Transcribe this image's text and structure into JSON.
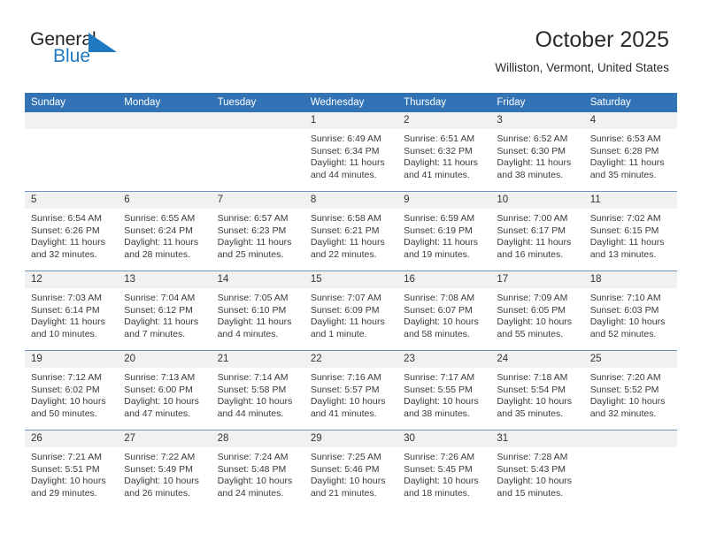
{
  "brand": {
    "name_part1": "General",
    "name_part2": "Blue",
    "triangle_color": "#1f79c0",
    "text_color": "#231f20",
    "accent_color": "#1f79c0"
  },
  "header": {
    "title": "October 2025",
    "subtitle": "Williston, Vermont, United States"
  },
  "theme": {
    "header_blue": "#3273b5",
    "daynum_band": "#f1f1f1",
    "row_border": "#6d93bb"
  },
  "calendar": {
    "weekday_headers": [
      "Sunday",
      "Monday",
      "Tuesday",
      "Wednesday",
      "Thursday",
      "Friday",
      "Saturday"
    ],
    "weeks": [
      [
        {
          "day": "",
          "empty": true
        },
        {
          "day": "",
          "empty": true
        },
        {
          "day": "",
          "empty": true
        },
        {
          "day": "1",
          "sunrise": "Sunrise: 6:49 AM",
          "sunset": "Sunset: 6:34 PM",
          "daylight": "Daylight: 11 hours and 44 minutes."
        },
        {
          "day": "2",
          "sunrise": "Sunrise: 6:51 AM",
          "sunset": "Sunset: 6:32 PM",
          "daylight": "Daylight: 11 hours and 41 minutes."
        },
        {
          "day": "3",
          "sunrise": "Sunrise: 6:52 AM",
          "sunset": "Sunset: 6:30 PM",
          "daylight": "Daylight: 11 hours and 38 minutes."
        },
        {
          "day": "4",
          "sunrise": "Sunrise: 6:53 AM",
          "sunset": "Sunset: 6:28 PM",
          "daylight": "Daylight: 11 hours and 35 minutes."
        }
      ],
      [
        {
          "day": "5",
          "sunrise": "Sunrise: 6:54 AM",
          "sunset": "Sunset: 6:26 PM",
          "daylight": "Daylight: 11 hours and 32 minutes."
        },
        {
          "day": "6",
          "sunrise": "Sunrise: 6:55 AM",
          "sunset": "Sunset: 6:24 PM",
          "daylight": "Daylight: 11 hours and 28 minutes."
        },
        {
          "day": "7",
          "sunrise": "Sunrise: 6:57 AM",
          "sunset": "Sunset: 6:23 PM",
          "daylight": "Daylight: 11 hours and 25 minutes."
        },
        {
          "day": "8",
          "sunrise": "Sunrise: 6:58 AM",
          "sunset": "Sunset: 6:21 PM",
          "daylight": "Daylight: 11 hours and 22 minutes."
        },
        {
          "day": "9",
          "sunrise": "Sunrise: 6:59 AM",
          "sunset": "Sunset: 6:19 PM",
          "daylight": "Daylight: 11 hours and 19 minutes."
        },
        {
          "day": "10",
          "sunrise": "Sunrise: 7:00 AM",
          "sunset": "Sunset: 6:17 PM",
          "daylight": "Daylight: 11 hours and 16 minutes."
        },
        {
          "day": "11",
          "sunrise": "Sunrise: 7:02 AM",
          "sunset": "Sunset: 6:15 PM",
          "daylight": "Daylight: 11 hours and 13 minutes."
        }
      ],
      [
        {
          "day": "12",
          "sunrise": "Sunrise: 7:03 AM",
          "sunset": "Sunset: 6:14 PM",
          "daylight": "Daylight: 11 hours and 10 minutes."
        },
        {
          "day": "13",
          "sunrise": "Sunrise: 7:04 AM",
          "sunset": "Sunset: 6:12 PM",
          "daylight": "Daylight: 11 hours and 7 minutes."
        },
        {
          "day": "14",
          "sunrise": "Sunrise: 7:05 AM",
          "sunset": "Sunset: 6:10 PM",
          "daylight": "Daylight: 11 hours and 4 minutes."
        },
        {
          "day": "15",
          "sunrise": "Sunrise: 7:07 AM",
          "sunset": "Sunset: 6:09 PM",
          "daylight": "Daylight: 11 hours and 1 minute."
        },
        {
          "day": "16",
          "sunrise": "Sunrise: 7:08 AM",
          "sunset": "Sunset: 6:07 PM",
          "daylight": "Daylight: 10 hours and 58 minutes."
        },
        {
          "day": "17",
          "sunrise": "Sunrise: 7:09 AM",
          "sunset": "Sunset: 6:05 PM",
          "daylight": "Daylight: 10 hours and 55 minutes."
        },
        {
          "day": "18",
          "sunrise": "Sunrise: 7:10 AM",
          "sunset": "Sunset: 6:03 PM",
          "daylight": "Daylight: 10 hours and 52 minutes."
        }
      ],
      [
        {
          "day": "19",
          "sunrise": "Sunrise: 7:12 AM",
          "sunset": "Sunset: 6:02 PM",
          "daylight": "Daylight: 10 hours and 50 minutes."
        },
        {
          "day": "20",
          "sunrise": "Sunrise: 7:13 AM",
          "sunset": "Sunset: 6:00 PM",
          "daylight": "Daylight: 10 hours and 47 minutes."
        },
        {
          "day": "21",
          "sunrise": "Sunrise: 7:14 AM",
          "sunset": "Sunset: 5:58 PM",
          "daylight": "Daylight: 10 hours and 44 minutes."
        },
        {
          "day": "22",
          "sunrise": "Sunrise: 7:16 AM",
          "sunset": "Sunset: 5:57 PM",
          "daylight": "Daylight: 10 hours and 41 minutes."
        },
        {
          "day": "23",
          "sunrise": "Sunrise: 7:17 AM",
          "sunset": "Sunset: 5:55 PM",
          "daylight": "Daylight: 10 hours and 38 minutes."
        },
        {
          "day": "24",
          "sunrise": "Sunrise: 7:18 AM",
          "sunset": "Sunset: 5:54 PM",
          "daylight": "Daylight: 10 hours and 35 minutes."
        },
        {
          "day": "25",
          "sunrise": "Sunrise: 7:20 AM",
          "sunset": "Sunset: 5:52 PM",
          "daylight": "Daylight: 10 hours and 32 minutes."
        }
      ],
      [
        {
          "day": "26",
          "sunrise": "Sunrise: 7:21 AM",
          "sunset": "Sunset: 5:51 PM",
          "daylight": "Daylight: 10 hours and 29 minutes."
        },
        {
          "day": "27",
          "sunrise": "Sunrise: 7:22 AM",
          "sunset": "Sunset: 5:49 PM",
          "daylight": "Daylight: 10 hours and 26 minutes."
        },
        {
          "day": "28",
          "sunrise": "Sunrise: 7:24 AM",
          "sunset": "Sunset: 5:48 PM",
          "daylight": "Daylight: 10 hours and 24 minutes."
        },
        {
          "day": "29",
          "sunrise": "Sunrise: 7:25 AM",
          "sunset": "Sunset: 5:46 PM",
          "daylight": "Daylight: 10 hours and 21 minutes."
        },
        {
          "day": "30",
          "sunrise": "Sunrise: 7:26 AM",
          "sunset": "Sunset: 5:45 PM",
          "daylight": "Daylight: 10 hours and 18 minutes."
        },
        {
          "day": "31",
          "sunrise": "Sunrise: 7:28 AM",
          "sunset": "Sunset: 5:43 PM",
          "daylight": "Daylight: 10 hours and 15 minutes."
        },
        {
          "day": "",
          "empty": true
        }
      ]
    ]
  }
}
